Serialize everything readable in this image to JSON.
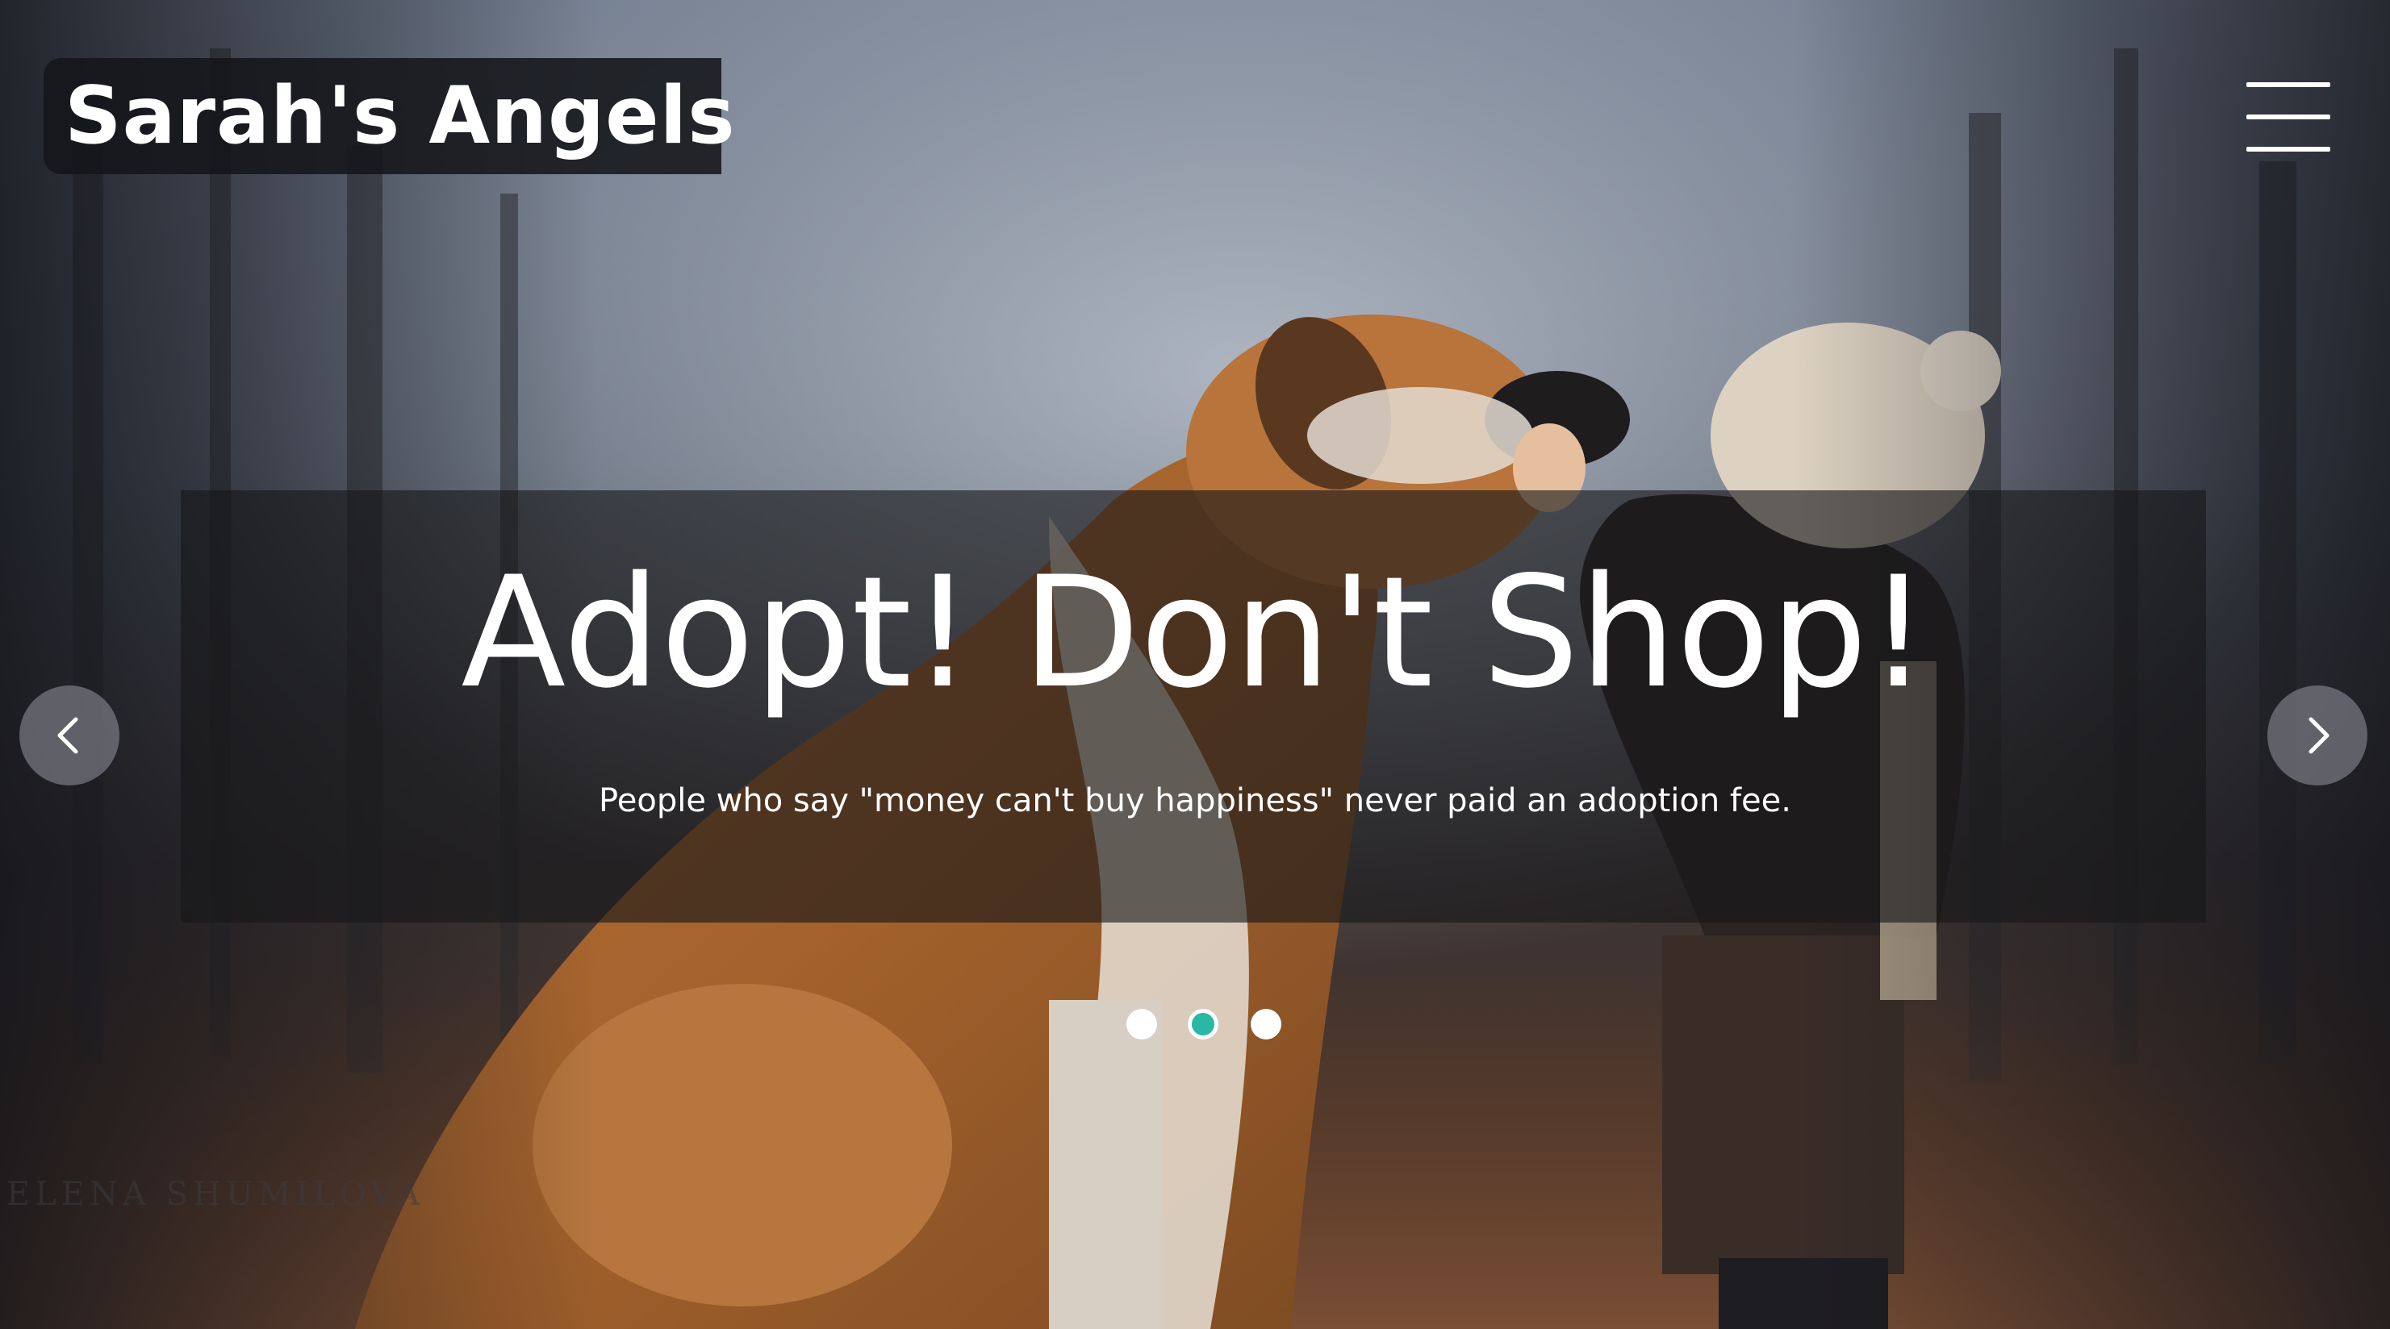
{
  "brand": {
    "name": "Sarah's Angels"
  },
  "nav": {
    "menu_icon": "hamburger-menu-icon"
  },
  "carousel": {
    "headline": "Adopt! Don't Shop!",
    "caption": "People who say \"money can't buy happiness\" never paid an adoption fee.",
    "prev_icon": "chevron-left-icon",
    "next_icon": "chevron-right-icon",
    "slide_count": 3,
    "active_slide": 2,
    "indicator_active_color": "#2bb7a5",
    "image_description_watermark": "ELENA SHUMILOVA"
  },
  "colors": {
    "text": "#ffffff",
    "accent": "#2bb7a5",
    "panel": "#161618"
  }
}
